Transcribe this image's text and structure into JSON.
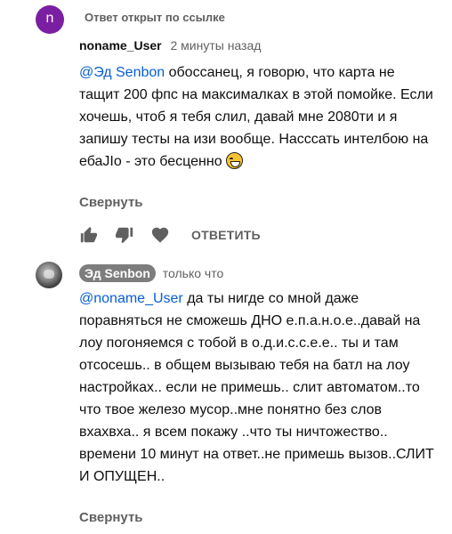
{
  "thread": {
    "open_by_link_badge": "Ответ открыт по ссылке"
  },
  "comment1": {
    "avatar_letter": "n",
    "author": "noname_User",
    "time": "2 минуты назад",
    "mention": "@Эд Senbon",
    "text": " обоссанец, я говорю, что карта не тащит 200 фпс на максималках в этой помойке. Если хочешь, чтоб я тебя слил, давай мне 2080ти и я запишу тесты на изи вообще. Нассcать интелбою на ебаJIo - это бесценно ",
    "emoji": "face-with-tears-of-joy-icon",
    "collapse_label": "Свернуть",
    "reply_label": "ОТВЕТИТЬ"
  },
  "comment2": {
    "author": "Эд Senbon",
    "time": "только что",
    "mention": "@noname_User",
    "text": " да ты нигде со мной даже поравняться не сможешь ДНО е.п.а.н.о.е..давай на лоу погоняемся с тобой в о.д.и.с.с.е.е.. ты и там отсосешь.. в общем вызываю тебя на батл на лоу настройках.. если не примешь.. слит автоматом..то что твое железо мусор..мне понятно без слов вхахвха.. я всем покажу ..что ты ничтожество.. времени 10 минут на ответ..не примешь вызов..СЛИТ И ОПУЩЕН..",
    "collapse_label": "Свернуть"
  },
  "colors": {
    "mention": "#065fd4",
    "avatar_n": "#7b1fa2",
    "author_chip": "#7d7d7d",
    "secondary_text": "#606060"
  }
}
